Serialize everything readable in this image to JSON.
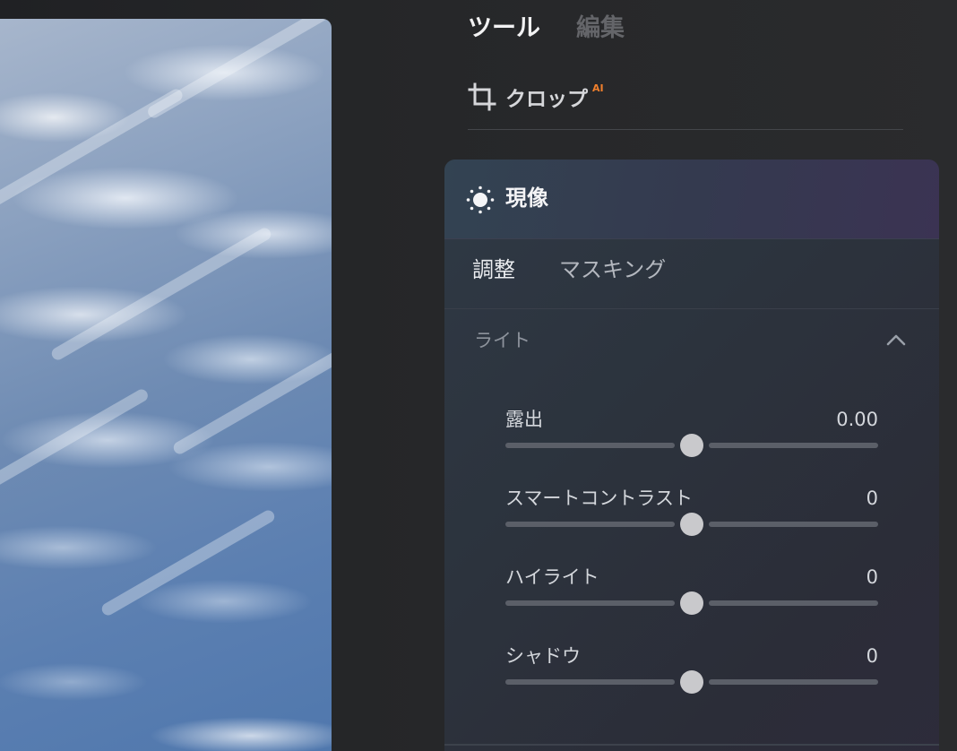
{
  "tabs": {
    "tools": "ツール",
    "edit": "編集"
  },
  "crop": {
    "label": "クロップ",
    "badge": "AI"
  },
  "develop": {
    "title": "現像",
    "subtabs": {
      "adjust": "調整",
      "masking": "マスキング"
    },
    "section": {
      "label": "ライト",
      "expanded": true
    },
    "sliders": [
      {
        "label": "露出",
        "value": "0.00",
        "level": 0.5
      },
      {
        "label": "スマートコントラスト",
        "value": "0",
        "level": 0.5
      },
      {
        "label": "ハイライト",
        "value": "0",
        "level": 0.5
      },
      {
        "label": "シャドウ",
        "value": "0",
        "level": 0.5
      }
    ]
  },
  "colors": {
    "accent_badge": "#f07f2c",
    "active_tab": "#f2f2f3",
    "inactive_tab": "#646569",
    "thumb": "#c9c9cc"
  },
  "icons": {
    "crop": "crop-icon",
    "develop": "sun-icon",
    "section_toggle": "chevron-up-icon"
  }
}
